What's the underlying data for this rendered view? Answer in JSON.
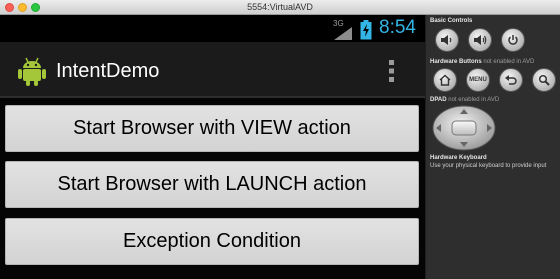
{
  "window": {
    "title": "5554:VirtualAVD"
  },
  "status_bar": {
    "network": "3G",
    "signal_icon": "signal-bars-icon",
    "battery_icon": "battery-charging-icon",
    "time": "8:54",
    "accent_color": "#33b5e5"
  },
  "action_bar": {
    "app_icon": "android-robot-icon",
    "title": "IntentDemo",
    "overflow_icon": "overflow-menu-icon"
  },
  "buttons": [
    {
      "label": "Start Browser with VIEW action"
    },
    {
      "label": "Start Browser with LAUNCH action"
    },
    {
      "label": "Exception Condition"
    }
  ],
  "emulator_panel": {
    "basic_controls_label": "Basic Controls",
    "hardware_buttons_label": "Hardware Buttons",
    "hardware_buttons_note": "not enabled in AVD",
    "menu_label": "MENU",
    "dpad_label": "DPAD",
    "dpad_note": "not enabled in AVD",
    "keyboard_label": "Hardware Keyboard",
    "keyboard_hint": "Use your physical keyboard to provide input"
  }
}
